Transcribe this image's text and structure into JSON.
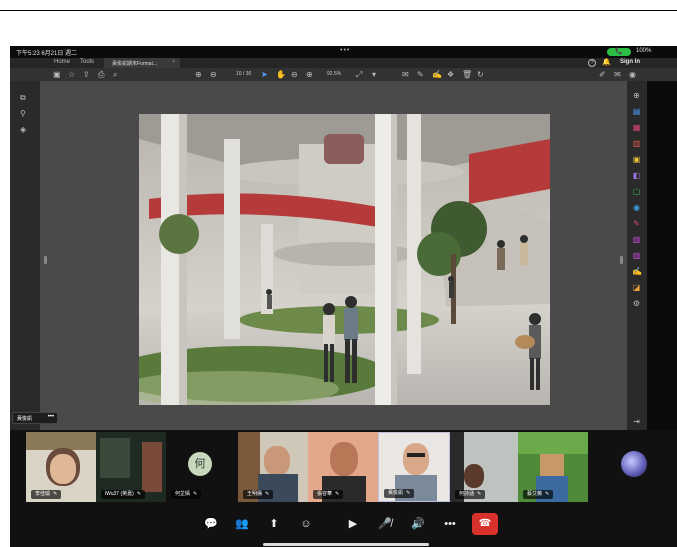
{
  "status_bar": {
    "time": "下午5:23  6月21日 週二",
    "dots": "•••",
    "call_pill": "📞",
    "battery": "100%"
  },
  "app": {
    "tabs": {
      "home": "Home",
      "tools": "Tools",
      "doc_title": "黃俊凱期末Format...",
      "doc_close": "×"
    },
    "help": "?",
    "signin": "Sign In",
    "toolbar": {
      "page": "10 / 30",
      "zoom": "92.5%"
    }
  },
  "name_chip": {
    "name": "黃俊凱",
    "more": "•••"
  },
  "participants": [
    {
      "name": "李佳瑜"
    },
    {
      "name": "iWu37 (英嘉)"
    },
    {
      "name": "何芷嫣",
      "initial": "何"
    },
    {
      "name": "王明儒"
    },
    {
      "name": "張容華"
    },
    {
      "name": "黃俊凱"
    },
    {
      "name": "何詩涵"
    },
    {
      "name": "蔡艾薇"
    }
  ],
  "icons": {
    "mic_off": "🎤̸",
    "speaker": "🔊",
    "more": "•••",
    "hangup": "☎"
  },
  "colors": {
    "hangup": "#d9312b",
    "call_pill": "#2bbf46",
    "accent": "#4da3ff"
  }
}
